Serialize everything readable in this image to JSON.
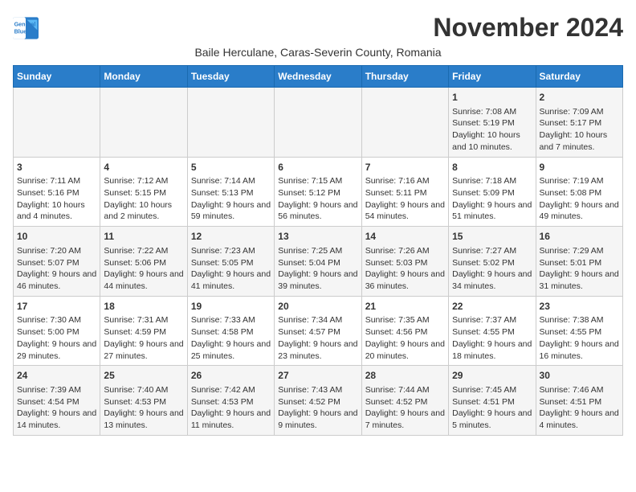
{
  "logo": {
    "line1": "General",
    "line2": "Blue"
  },
  "title": "November 2024",
  "subtitle": "Baile Herculane, Caras-Severin County, Romania",
  "days_of_week": [
    "Sunday",
    "Monday",
    "Tuesday",
    "Wednesday",
    "Thursday",
    "Friday",
    "Saturday"
  ],
  "weeks": [
    [
      {
        "day": "",
        "info": ""
      },
      {
        "day": "",
        "info": ""
      },
      {
        "day": "",
        "info": ""
      },
      {
        "day": "",
        "info": ""
      },
      {
        "day": "",
        "info": ""
      },
      {
        "day": "1",
        "info": "Sunrise: 7:08 AM\nSunset: 5:19 PM\nDaylight: 10 hours and 10 minutes."
      },
      {
        "day": "2",
        "info": "Sunrise: 7:09 AM\nSunset: 5:17 PM\nDaylight: 10 hours and 7 minutes."
      }
    ],
    [
      {
        "day": "3",
        "info": "Sunrise: 7:11 AM\nSunset: 5:16 PM\nDaylight: 10 hours and 4 minutes."
      },
      {
        "day": "4",
        "info": "Sunrise: 7:12 AM\nSunset: 5:15 PM\nDaylight: 10 hours and 2 minutes."
      },
      {
        "day": "5",
        "info": "Sunrise: 7:14 AM\nSunset: 5:13 PM\nDaylight: 9 hours and 59 minutes."
      },
      {
        "day": "6",
        "info": "Sunrise: 7:15 AM\nSunset: 5:12 PM\nDaylight: 9 hours and 56 minutes."
      },
      {
        "day": "7",
        "info": "Sunrise: 7:16 AM\nSunset: 5:11 PM\nDaylight: 9 hours and 54 minutes."
      },
      {
        "day": "8",
        "info": "Sunrise: 7:18 AM\nSunset: 5:09 PM\nDaylight: 9 hours and 51 minutes."
      },
      {
        "day": "9",
        "info": "Sunrise: 7:19 AM\nSunset: 5:08 PM\nDaylight: 9 hours and 49 minutes."
      }
    ],
    [
      {
        "day": "10",
        "info": "Sunrise: 7:20 AM\nSunset: 5:07 PM\nDaylight: 9 hours and 46 minutes."
      },
      {
        "day": "11",
        "info": "Sunrise: 7:22 AM\nSunset: 5:06 PM\nDaylight: 9 hours and 44 minutes."
      },
      {
        "day": "12",
        "info": "Sunrise: 7:23 AM\nSunset: 5:05 PM\nDaylight: 9 hours and 41 minutes."
      },
      {
        "day": "13",
        "info": "Sunrise: 7:25 AM\nSunset: 5:04 PM\nDaylight: 9 hours and 39 minutes."
      },
      {
        "day": "14",
        "info": "Sunrise: 7:26 AM\nSunset: 5:03 PM\nDaylight: 9 hours and 36 minutes."
      },
      {
        "day": "15",
        "info": "Sunrise: 7:27 AM\nSunset: 5:02 PM\nDaylight: 9 hours and 34 minutes."
      },
      {
        "day": "16",
        "info": "Sunrise: 7:29 AM\nSunset: 5:01 PM\nDaylight: 9 hours and 31 minutes."
      }
    ],
    [
      {
        "day": "17",
        "info": "Sunrise: 7:30 AM\nSunset: 5:00 PM\nDaylight: 9 hours and 29 minutes."
      },
      {
        "day": "18",
        "info": "Sunrise: 7:31 AM\nSunset: 4:59 PM\nDaylight: 9 hours and 27 minutes."
      },
      {
        "day": "19",
        "info": "Sunrise: 7:33 AM\nSunset: 4:58 PM\nDaylight: 9 hours and 25 minutes."
      },
      {
        "day": "20",
        "info": "Sunrise: 7:34 AM\nSunset: 4:57 PM\nDaylight: 9 hours and 23 minutes."
      },
      {
        "day": "21",
        "info": "Sunrise: 7:35 AM\nSunset: 4:56 PM\nDaylight: 9 hours and 20 minutes."
      },
      {
        "day": "22",
        "info": "Sunrise: 7:37 AM\nSunset: 4:55 PM\nDaylight: 9 hours and 18 minutes."
      },
      {
        "day": "23",
        "info": "Sunrise: 7:38 AM\nSunset: 4:55 PM\nDaylight: 9 hours and 16 minutes."
      }
    ],
    [
      {
        "day": "24",
        "info": "Sunrise: 7:39 AM\nSunset: 4:54 PM\nDaylight: 9 hours and 14 minutes."
      },
      {
        "day": "25",
        "info": "Sunrise: 7:40 AM\nSunset: 4:53 PM\nDaylight: 9 hours and 13 minutes."
      },
      {
        "day": "26",
        "info": "Sunrise: 7:42 AM\nSunset: 4:53 PM\nDaylight: 9 hours and 11 minutes."
      },
      {
        "day": "27",
        "info": "Sunrise: 7:43 AM\nSunset: 4:52 PM\nDaylight: 9 hours and 9 minutes."
      },
      {
        "day": "28",
        "info": "Sunrise: 7:44 AM\nSunset: 4:52 PM\nDaylight: 9 hours and 7 minutes."
      },
      {
        "day": "29",
        "info": "Sunrise: 7:45 AM\nSunset: 4:51 PM\nDaylight: 9 hours and 5 minutes."
      },
      {
        "day": "30",
        "info": "Sunrise: 7:46 AM\nSunset: 4:51 PM\nDaylight: 9 hours and 4 minutes."
      }
    ]
  ]
}
